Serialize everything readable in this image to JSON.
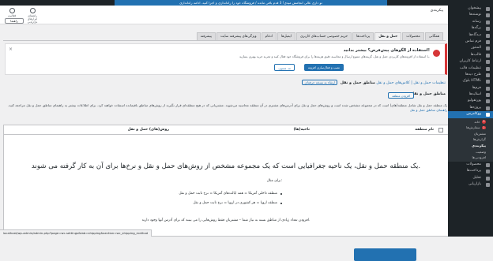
{
  "admin_bar": {
    "notice": "تو داری عالی انجامش میدی! 3 قدم باقی مانده / فروشگاه خود را راه‌اندازی و اجرا کنید. ادامه راه‌اندازی"
  },
  "top": {
    "breadcrumb": "پیکربندی",
    "activity_label": "فعالیت",
    "help_label": "راهنمای ابزارهای بازاریابی",
    "language_value": "راهنما"
  },
  "tabs": [
    "همگانی",
    "محصولات",
    "حمل و نقل",
    "پرداخت‌ها",
    "حریم خصوصی حساب‌های کاربری",
    "ایمیل‌ها",
    "ادغام",
    "ویژگی‌های پیشرفته سایت",
    "پیشرفته"
  ],
  "active_tab": "حمل و نقل",
  "notice": {
    "title": "استفاده از الگوهای پیش‌فرض؟ بیشتر بدانید!",
    "text": "با استفاده از افزونه‌های کاربردی حمل و نقل، گزینه‌های متنوع ارسال و محاسبه دقیق هزینه‌ها را برای فروشگاه خود فعال کنید و تجربه خرید بهتری بسازید.",
    "primary_button": "نصب و فعال‌سازی افزونه",
    "secondary_button": "نه، ممنون"
  },
  "zones": {
    "title": "مناطق حمل و نقل",
    "links": "تنظیمات حمل و نقل | کلاس‌های حمل و نقل",
    "pro_button": "ارتقاء به نسخه حرفه‌ای",
    "subtitle": "مناطق حمل و نقل",
    "add_button": "افزودن منطقه",
    "description": "یک منطقه حمل و نقل شامل منطقه(های) است که در مجموعه مشخص شده است و روش‌های حمل و نقل برای آدرس‌های مشتری در آن منطقه محاسبه می‌شوند. مشتریانی که در هیچ منطقه‌ای قرار نگیرند از روش‌های مناطق باقیمانده استفاده خواهند کرد. برای اطلاعات بیشتر به راهنمای مناطق حمل و نقل مراجعه کنید.",
    "link_text": "راهنمای مناطق حمل و نقل"
  },
  "table": {
    "headers": [
      "نام منطقه",
      "ناحیه(ها)",
      "روش(های) حمل و نقل"
    ],
    "empty_title": "یک منطقه حمل و نقل، یک ناحیه جغرافیایی است که یک مجموعه مشخص از روش‌های حمل و نقل و نرخ‌ها برای آن به کار گرفته می شوند.",
    "examples_label": "برای مثال:",
    "examples": [
      "منطقه داخلی آمریکا = همه ایالت‌های آمریکا = نرخ ثابت حمل و نقل",
      "منطقه اروپا = هر کشوری در اروپا = نرخ ثابت حمل و نقل"
    ],
    "note": "افزودن تعداد زیادی از مناطق بسته به نیاز شما – مشتریان فقط روش‌هایی را می بینند که برای آدرس آنها وجود دارند."
  },
  "sidebar": {
    "items": [
      {
        "label": "پیشخوان",
        "icon": "dashboard-icon"
      },
      {
        "label": "نوشته‌ها",
        "icon": "pin-icon"
      },
      {
        "label": "رسانه",
        "icon": "media-icon"
      },
      {
        "label": "برگه‌ها",
        "icon": "page-icon"
      },
      {
        "label": "دیدگاه‌ها",
        "icon": "comment-icon"
      },
      {
        "label": "فرم تماس",
        "icon": "mail-icon"
      },
      {
        "label": "المنتور",
        "icon": "elementor-icon"
      },
      {
        "label": "قالب‌ها",
        "icon": "template-icon"
      },
      {
        "label": "ارتباط کاربران",
        "icon": "users-icon"
      },
      {
        "label": "تنظیمات قالب",
        "icon": "settings-icon"
      },
      {
        "label": "طرح دیدها",
        "icon": "layout-icon"
      },
      {
        "label": "بلوک HTML",
        "icon": "code-icon"
      },
      {
        "label": "فرم‌ها",
        "icon": "form-icon"
      },
      {
        "label": "اسلایدها",
        "icon": "slides-icon"
      },
      {
        "label": "پورتفولیو",
        "icon": "portfolio-icon"
      },
      {
        "label": "پروژه‌ها",
        "icon": "project-icon"
      }
    ],
    "woocommerce": "ووکامرس",
    "woo_sub": [
      {
        "label": "خانه",
        "badge": "3"
      },
      {
        "label": "سفارش‌ها",
        "badge": "2"
      },
      {
        "label": "مشتریان",
        "badge": ""
      },
      {
        "label": "گزارش‌ها",
        "badge": ""
      },
      {
        "label": "پیکربندی",
        "badge": ""
      },
      {
        "label": "وضعیت",
        "badge": ""
      },
      {
        "label": "افزودنی‌ها",
        "badge": ""
      }
    ],
    "current_sub": "پیکربندی",
    "bottom_items": [
      {
        "label": "محصولات",
        "icon": "product-icon"
      },
      {
        "label": "پرداخت‌ها",
        "icon": "payment-icon"
      },
      {
        "label": "تحلیل",
        "icon": "analytics-icon"
      },
      {
        "label": "بازاریابی",
        "icon": "marketing-icon"
      }
    ]
  },
  "status_bar": {
    "url": "localhost/wp-admin/admin.php?page=wc-settings&tab=shipping&section=wc_shipping_method"
  }
}
